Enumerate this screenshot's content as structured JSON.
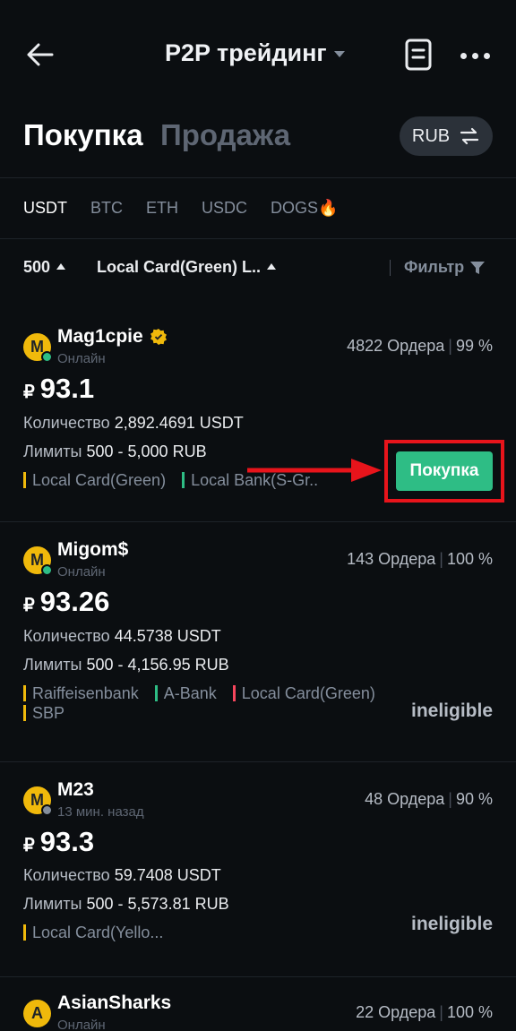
{
  "header": {
    "title": "P2P трейдинг",
    "tabs": [
      "Покупка",
      "Продажа"
    ],
    "currency": "RUB"
  },
  "coins": [
    "USDT",
    "BTC",
    "ETH",
    "USDC",
    "DOGS🔥"
  ],
  "filters": {
    "amount": "500",
    "payment": "Local Card(Green) L..",
    "filter_label": "Фильтр"
  },
  "ads": [
    {
      "avatar": "M",
      "name": "Mag1cpie",
      "status": "Онлайн",
      "orders": "4822 Ордера",
      "completion": "99 %",
      "currency_symbol": "₽",
      "price": "93.1",
      "quantity_label": "Количество",
      "quantity": "2,892.4691 USDT",
      "limits_label": "Лимиты",
      "limits": "500 - 5,000 RUB",
      "payments": [
        "Local Card(Green)",
        "Local Bank(S-Gr.."
      ],
      "action": "Покупка"
    },
    {
      "avatar": "M",
      "name": "Migom$",
      "status": "Онлайн",
      "orders": "143 Ордера",
      "completion": "100 %",
      "currency_symbol": "₽",
      "price": "93.26",
      "quantity_label": "Количество",
      "quantity": "44.5738 USDT",
      "limits_label": "Лимиты",
      "limits": "500 - 4,156.95 RUB",
      "payments": [
        "Raiffeisenbank",
        "A-Bank",
        "Local Card(Green)",
        "SBP"
      ],
      "action": "ineligible"
    },
    {
      "avatar": "M",
      "name": "M23",
      "status": "13 мин. назад",
      "orders": "48 Ордера",
      "completion": "90 %",
      "currency_symbol": "₽",
      "price": "93.3",
      "quantity_label": "Количество",
      "quantity": "59.7408 USDT",
      "limits_label": "Лимиты",
      "limits": "500 - 5,573.81 RUB",
      "payments": [
        "Local Card(Yello..."
      ],
      "action": "ineligible"
    },
    {
      "avatar": "A",
      "name": "AsianSharks",
      "status": "Онлайн",
      "orders": "22 Ордера",
      "completion": "100 %"
    }
  ],
  "colors": {
    "background": "#0b0e11",
    "accent_green": "#2ebd85",
    "avatar_yellow": "#f0b90b",
    "highlight_red": "#e8141b"
  }
}
